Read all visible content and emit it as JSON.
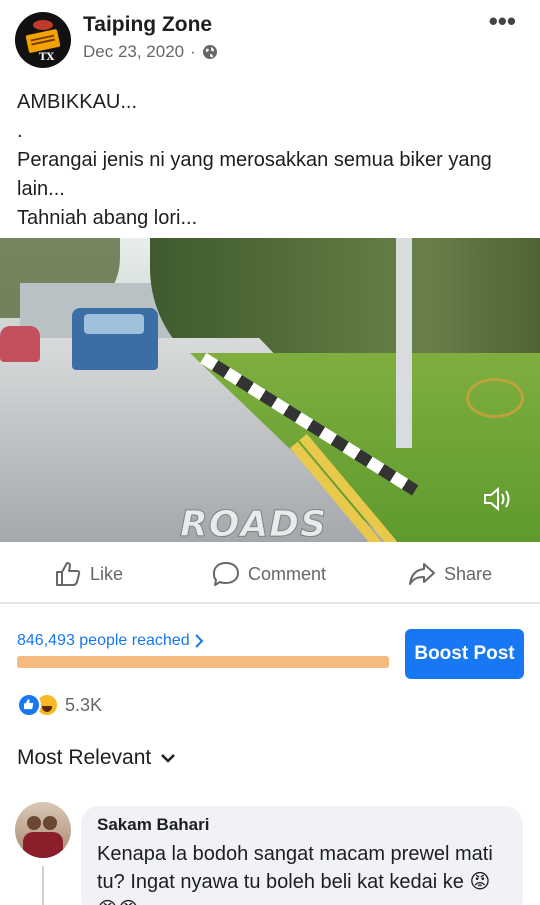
{
  "post": {
    "page_name": "Taiping Zone",
    "date": "Dec 23, 2020",
    "separator": "·",
    "visibility_icon": "globe-icon",
    "more_icon": "more-options-icon",
    "lines": [
      "AMBIKKAU...",
      ".",
      "Perangai jenis ni yang merosakkan semua biker yang lain...",
      "Tahniah abang lori..."
    ]
  },
  "video": {
    "watermark": "ROADS",
    "volume_icon": "volume-icon"
  },
  "actions": {
    "like": "Like",
    "comment": "Comment",
    "share": "Share"
  },
  "insights": {
    "reached": "846,493 people reached",
    "progress": 1.0,
    "boost_label": "Boost Post"
  },
  "reactions": {
    "count": "5.3K",
    "types": [
      "like",
      "haha"
    ]
  },
  "sort": {
    "label": "Most Relevant"
  },
  "comment": {
    "author": "Sakam Bahari",
    "text": "Kenapa la bodoh sangat macam prewel mati tu? Ingat nyawa tu boleh beli kat kedai ke 😡😡😡"
  },
  "colors": {
    "accent": "#1877f2",
    "secondary_text": "#65676b",
    "progress": "#f6b97e",
    "bubble": "#f0f2f5"
  }
}
